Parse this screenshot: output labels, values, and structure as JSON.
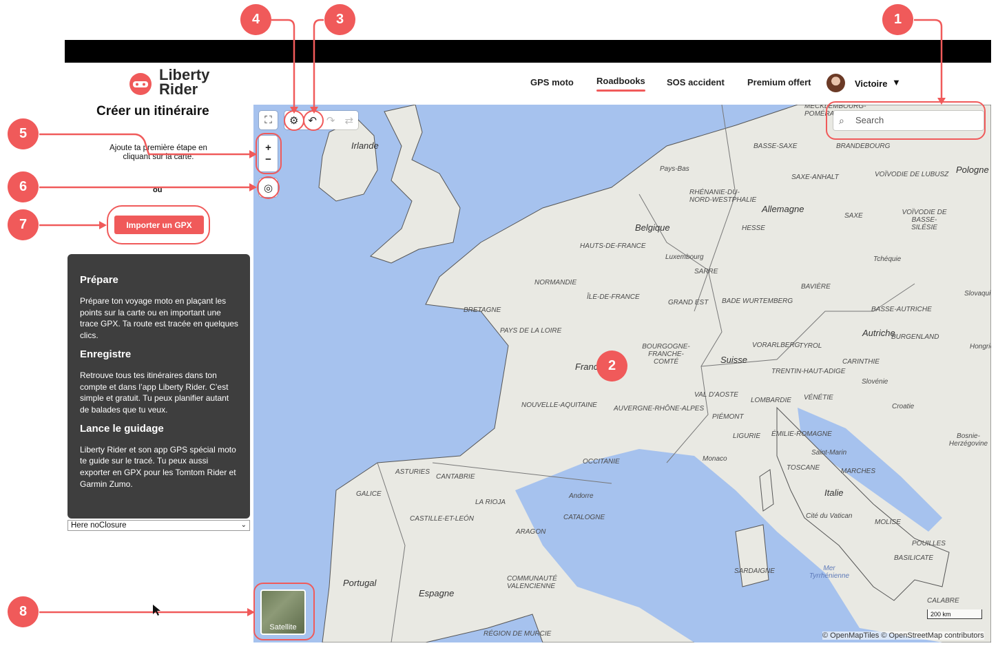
{
  "header": {
    "brand": "Liberty Rider",
    "nav": [
      "GPS moto",
      "Roadbooks",
      "SOS accident",
      "Premium offert"
    ],
    "active_nav": "Roadbooks",
    "user": "Victoire"
  },
  "sidebar": {
    "title": "Créer un itinéraire",
    "hint": "Ajoute ta première étape en cliquant sur la carte.",
    "or": "ou",
    "import_button": "Importer un GPX",
    "info": [
      {
        "heading": "Prépare",
        "text": "Prépare ton voyage moto en plaçant les points sur la carte ou en important une trace GPX. Ta route est tracée en quelques clics."
      },
      {
        "heading": "Enregistre",
        "text": "Retrouve tous tes itinéraires dans ton compte et dans l’app Liberty Rider. C’est simple et gratuit. Tu peux planifier autant de balades que tu veux."
      },
      {
        "heading": "Lance le guidage",
        "text": "Liberty Rider et son app GPS spécial moto te guide sur le tracé. Tu peux aussi exporter en GPX pour les Tomtom Rider et Garmin Zumo."
      }
    ],
    "routing_select": "Here noClosure"
  },
  "map": {
    "search_placeholder": "Search",
    "satellite_label": "Satellite",
    "scale": "200 km",
    "attribution": "© OpenMapTiles © OpenStreetMap contributors",
    "labels": [
      {
        "text": "Irlande",
        "country": true
      },
      {
        "text": "Belgique",
        "country": true
      },
      {
        "text": "Allemagne",
        "country": true
      },
      {
        "text": "Pays-Bas",
        "country": true
      },
      {
        "text": "Luxembourg",
        "country": false
      },
      {
        "text": "Tchéquie",
        "country": false
      },
      {
        "text": "Suisse",
        "country": true
      },
      {
        "text": "Autriche",
        "country": true
      },
      {
        "text": "Italie",
        "country": true
      },
      {
        "text": "Espagne",
        "country": true
      },
      {
        "text": "Portugal",
        "country": true
      },
      {
        "text": "France",
        "country": true
      },
      {
        "text": "NORMANDIE",
        "country": false
      },
      {
        "text": "BRETAGNE",
        "country": false
      },
      {
        "text": "PAYS DE LA LOIRE",
        "country": false
      },
      {
        "text": "ÎLE-DE-FRANCE",
        "country": false
      },
      {
        "text": "GRAND EST",
        "country": false
      },
      {
        "text": "HAUTS-DE-FRANCE",
        "country": false
      },
      {
        "text": "BOURGOGNE-FRANCHE-COMTÉ",
        "country": false
      },
      {
        "text": "NOUVELLE-AQUITAINE",
        "country": false
      },
      {
        "text": "AUVERGNE-RHÔNE-ALPES",
        "country": false
      },
      {
        "text": "OCCITANIE",
        "country": false
      },
      {
        "text": "Andorre",
        "country": false
      },
      {
        "text": "CATALOGNE",
        "country": false
      },
      {
        "text": "ARAGON",
        "country": false
      },
      {
        "text": "LA RIOJA",
        "country": false
      },
      {
        "text": "CANTABRIE",
        "country": false
      },
      {
        "text": "ASTURIES",
        "country": false
      },
      {
        "text": "GALICE",
        "country": false
      },
      {
        "text": "CASTILLE-ET-LEÓN",
        "country": false
      },
      {
        "text": "COMMUNAUTÉ VALENCIENNE",
        "country": false
      },
      {
        "text": "RÉGION DE MURCIE",
        "country": false
      },
      {
        "text": "Monaco",
        "country": false
      },
      {
        "text": "SARDAIGNE",
        "country": false
      },
      {
        "text": "Cité du Vatican",
        "country": false
      },
      {
        "text": "TOSCANE",
        "country": false
      },
      {
        "text": "LOMBARDIE",
        "country": false
      },
      {
        "text": "PIÉMONT",
        "country": false
      },
      {
        "text": "LIGURIE",
        "country": false
      },
      {
        "text": "ÉMILIE-ROMAGNE",
        "country": false
      },
      {
        "text": "VÉNÉTIE",
        "country": false
      },
      {
        "text": "BAVIÈRE",
        "country": false
      },
      {
        "text": "BADE WURTEMBERG",
        "country": false
      },
      {
        "text": "HESSE",
        "country": false
      },
      {
        "text": "SAXE",
        "country": false
      },
      {
        "text": "SAXE-ANHALT",
        "country": false
      },
      {
        "text": "BASSE-SAXE",
        "country": false
      },
      {
        "text": "BRANDEBOURG",
        "country": false
      },
      {
        "text": "RHÉNANIE-DU-NORD-WESTPHALIE",
        "country": false
      },
      {
        "text": "SARRE",
        "country": false
      },
      {
        "text": "Slovénie",
        "country": false
      },
      {
        "text": "Croatie",
        "country": false
      },
      {
        "text": "VORARLBERG",
        "country": false
      },
      {
        "text": "TYROL",
        "country": false
      },
      {
        "text": "CARINTHIE",
        "country": false
      },
      {
        "text": "BASSE-AUTRICHE",
        "country": false
      },
      {
        "text": "BURGENLAND",
        "country": false
      },
      {
        "text": "VAL D'AOSTE",
        "country": false
      },
      {
        "text": "TRENTIN-HAUT-ADIGE",
        "country": false
      },
      {
        "text": "MARCHES",
        "country": false
      },
      {
        "text": "Saint-Marin",
        "country": false
      },
      {
        "text": "MOLISE",
        "country": false
      },
      {
        "text": "POUILLES",
        "country": false
      },
      {
        "text": "BASILICATE",
        "country": false
      },
      {
        "text": "CALABRE",
        "country": false
      },
      {
        "text": "Mer Tyrrhénienne",
        "country": false
      },
      {
        "text": "Bosnie-Herzégovine",
        "country": false
      },
      {
        "text": "Pologne",
        "country": true
      },
      {
        "text": "VOÏVODIE DE LUBUSZ",
        "country": false
      },
      {
        "text": "VOÏVODIE DE BASSE-SILÉSIE",
        "country": false
      },
      {
        "text": "MECKLEMBOURG-POMÉRANIE",
        "country": false
      },
      {
        "text": "Slovaquie",
        "country": false
      },
      {
        "text": "Hongrie",
        "country": false
      }
    ]
  },
  "callouts": [
    "1",
    "2",
    "3",
    "4",
    "5",
    "6",
    "7",
    "8"
  ]
}
